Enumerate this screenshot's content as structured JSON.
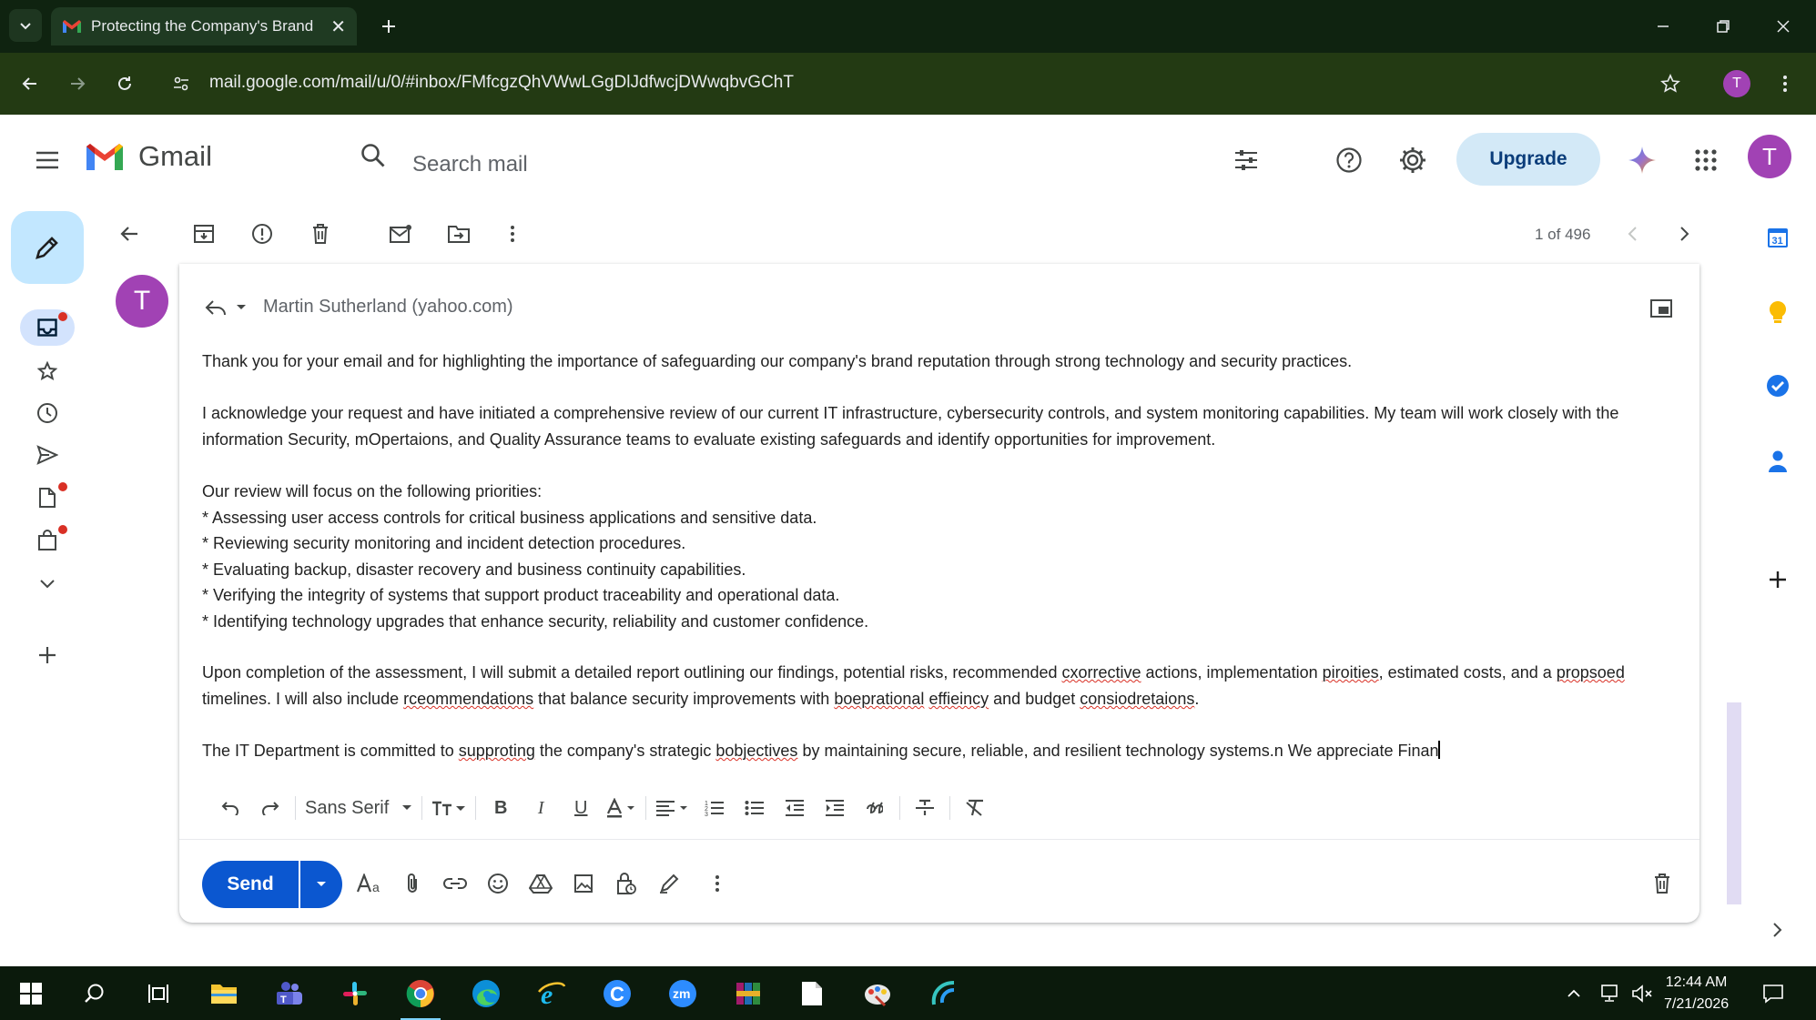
{
  "browser": {
    "tab_title": "Protecting the Company's Brand",
    "url": "mail.google.com/mail/u/0/#inbox/FMfcgzQhVWwLGgDlJdfwcjDWwqbvGChT",
    "profile_initial": "T"
  },
  "gmail": {
    "app_name": "Gmail",
    "search_placeholder": "Search mail",
    "upgrade_label": "Upgrade",
    "account_initial": "T",
    "pager": "1 of 496"
  },
  "message": {
    "sender_initial": "T",
    "recipient": "Martin Sutherland (yahoo.com)",
    "para1": "Thank you for your email and for highlighting the importance of safeguarding our company's brand reputation through strong technology and security practices.",
    "para2": "I acknowledge your request and have initiated a comprehensive review of our current IT infrastructure, cybersecurity controls, and system monitoring capabilities. My team will work closely with the information Security, mOpertaions, and Quality Assurance teams to evaluate existing safeguards and identify opportunities for improvement.",
    "list_intro": "Our review will focus on the following priorities:",
    "list": [
      "* Assessing user access controls for critical business applications and sensitive data.",
      "* Reviewing security monitoring and incident detection procedures.",
      "* Evaluating backup, disaster recovery and business continuity capabilities.",
      "* Verifying the integrity of systems that support product traceability and operational data.",
      "* Identifying technology upgrades that enhance security, reliability and customer confidence."
    ],
    "para3": {
      "a": "Upon completion of the assessment, I will submit a detailed report outlining our findings, potential risks, recommended ",
      "w1": "cxorrective",
      "b": " actions, implementation ",
      "w2": "piroities",
      "c": ", estimated costs, and a ",
      "w3": "propsoed",
      "d": " timelines. I will also include ",
      "w4": "rceommendations",
      "e": " that balance security improvements with ",
      "w5": "boeprational",
      "f": " ",
      "w6": "effieincy",
      "g": " and budget ",
      "w7": "consiodretaions",
      "h": "."
    },
    "para4": {
      "a": "The IT Department is committed to ",
      "w1": "supproting",
      "b": " the company's strategic ",
      "w2": "bobjectives",
      "c": " by maintaining secure, reliable, and resilient technology systems.n We appreciate Finan"
    }
  },
  "editor": {
    "font_name": "Sans Serif",
    "send_label": "Send"
  },
  "taskbar": {
    "time": "12:44 AM",
    "date": "7/21/2026"
  },
  "colors": {
    "send_blue": "#0b57d0",
    "compose_bg": "#c2e7ff",
    "avatar_purple": "#a142b4",
    "upgrade_bg": "#d3e9f7",
    "unread_dot": "#d93025"
  }
}
